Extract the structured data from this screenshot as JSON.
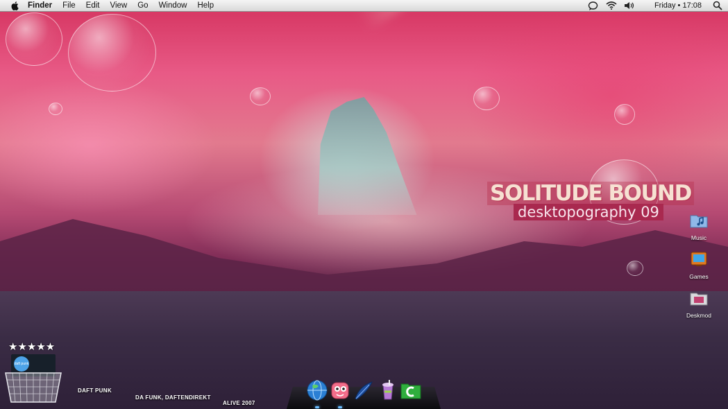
{
  "menubar": {
    "apple_icon": "apple-icon",
    "app_name": "Finder",
    "menus": [
      "File",
      "Edit",
      "View",
      "Go",
      "Window",
      "Help"
    ],
    "status_icons": [
      "chat-icon",
      "wifi-icon",
      "volume-icon"
    ],
    "clock": "Friday • 17:08",
    "search_icon": "spotlight-icon"
  },
  "wallpaper": {
    "logo_line1": "SOLITUDE BOUND",
    "logo_line2": "desktopography 09"
  },
  "desktop_icons": [
    {
      "label": "Music",
      "icon": "music-folder-icon"
    },
    {
      "label": "Games",
      "icon": "games-icon"
    },
    {
      "label": "Deskmod",
      "icon": "deskmod-folder-icon"
    }
  ],
  "now_playing": {
    "rating": 5,
    "rating_text": "★★★★★",
    "artist": "DAFT PUNK",
    "track": "DA FUNK, DAFTENDIREKT",
    "album": "ALIVE 2007",
    "cover_text": "daft punk"
  },
  "dock": {
    "items": [
      {
        "name": "globe-icon",
        "running": true
      },
      {
        "name": "pink-creature-icon",
        "running": true
      },
      {
        "name": "feather-icon",
        "running": false
      },
      {
        "name": "drink-cup-icon",
        "running": false
      },
      {
        "name": "green-folder-icon",
        "running": false
      }
    ]
  },
  "colors": {
    "accent_pink": "#a9294f",
    "dock_indicator": "#6bbcff"
  }
}
